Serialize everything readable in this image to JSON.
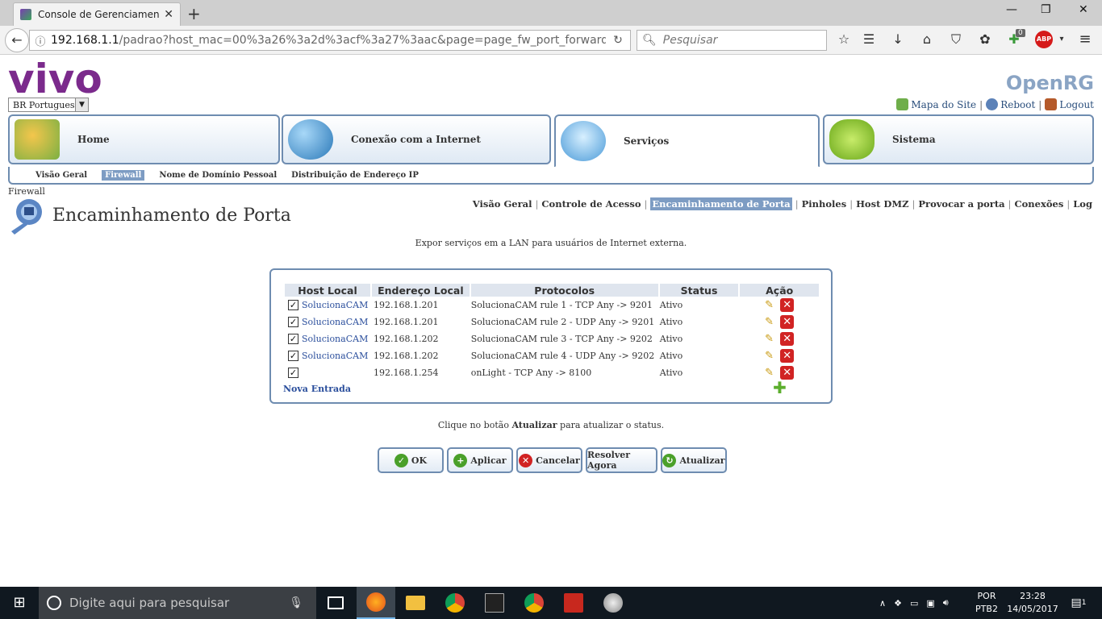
{
  "browser": {
    "tab_title": "Console de Gerenciamento (",
    "url_host": "192.168.1.1",
    "url_rest": "/padrao?host_mac=00%3a26%3a2d%3acf%3a27%3aac&page=page_fw_port_forwarding&prev",
    "search_placeholder": "Pesquisar",
    "addon_badge": "0",
    "abp_label": "ABP"
  },
  "header": {
    "logo": "vivo",
    "language": "BR Portuguese",
    "brand": "OpenRG",
    "links": [
      "Mapa do Site",
      "Reboot",
      "Logout"
    ]
  },
  "main_tabs": [
    {
      "label": "Home",
      "icon": "house-icon"
    },
    {
      "label": "Conexão com a Internet",
      "icon": "globe-icon"
    },
    {
      "label": "Serviços",
      "icon": "services-disc-icon"
    },
    {
      "label": "Sistema",
      "icon": "router-icon"
    }
  ],
  "sub_nav": [
    "Visão Geral",
    "Firewall",
    "Nome de Domínio Pessoal",
    "Distribuição de Endereço IP"
  ],
  "breadcrumb": "Firewall",
  "page_title": "Encaminhamento de Porta",
  "section_nav": [
    "Visão Geral",
    "Controle de Acesso",
    "Encaminhamento de Porta",
    "Pinholes",
    "Host DMZ",
    "Provocar a porta",
    "Conexões",
    "Log"
  ],
  "description": "Expor serviços em a LAN para usuários de Internet externa.",
  "table": {
    "headers": [
      "Host Local",
      "Endereço Local",
      "Protocolos",
      "Status",
      "Ação"
    ],
    "rows": [
      {
        "checked": true,
        "host": "SolucionaCAM",
        "ip": "192.168.1.201",
        "protocol": "SolucionaCAM rule 1 - TCP Any -> 9201",
        "status": "Ativo"
      },
      {
        "checked": true,
        "host": "SolucionaCAM",
        "ip": "192.168.1.201",
        "protocol": "SolucionaCAM rule 2 - UDP Any -> 9201",
        "status": "Ativo"
      },
      {
        "checked": true,
        "host": "SolucionaCAM",
        "ip": "192.168.1.202",
        "protocol": "SolucionaCAM rule 3 - TCP Any -> 9202",
        "status": "Ativo"
      },
      {
        "checked": true,
        "host": "SolucionaCAM",
        "ip": "192.168.1.202",
        "protocol": "SolucionaCAM rule 4 - UDP Any -> 9202",
        "status": "Ativo"
      },
      {
        "checked": true,
        "host": "",
        "ip": "192.168.1.254",
        "protocol": "onLight - TCP Any -> 8100",
        "status": "Ativo"
      }
    ],
    "new_entry": "Nova Entrada"
  },
  "hint": {
    "before": "Clique no botão ",
    "bold": "Atualizar",
    "after": " para atualizar o status."
  },
  "buttons": [
    {
      "label": "OK",
      "icon": "check-icon"
    },
    {
      "label": "Aplicar",
      "icon": "plus-icon"
    },
    {
      "label": "Cancelar",
      "icon": "cancel-icon"
    },
    {
      "label": "Resolver Agora",
      "icon": ""
    },
    {
      "label": "Atualizar",
      "icon": "refresh-icon"
    }
  ],
  "taskbar": {
    "search_placeholder": "Digite aqui para pesquisar",
    "lang_line1": "POR",
    "lang_line2": "PTB2",
    "time": "23:28",
    "date": "14/05/2017",
    "notification_count": "1"
  }
}
